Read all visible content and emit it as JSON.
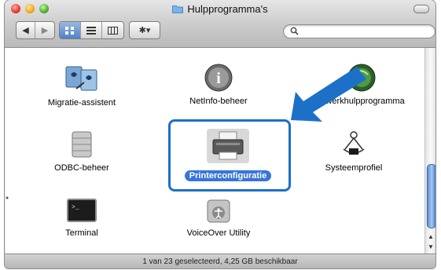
{
  "window": {
    "title": "Hulpprogramma's"
  },
  "toolbar": {
    "back_label": "◀",
    "forward_label": "▶",
    "action_label": "✱▾",
    "search_placeholder": ""
  },
  "items": [
    {
      "label": "Migratie-assistent"
    },
    {
      "label": "NetInfo-beheer"
    },
    {
      "label": "etwerkhulpprogramma"
    },
    {
      "label": "ODBC-beheer"
    },
    {
      "label": "Printerconfiguratie"
    },
    {
      "label": "Systeemprofiel"
    },
    {
      "label": "Terminal"
    },
    {
      "label": "VoiceOver Utility"
    }
  ],
  "status": {
    "text": "1 van 23 geselecteerd, 4,25 GB beschikbaar"
  },
  "colors": {
    "accent": "#1d70c8",
    "selection": "#3875d7"
  }
}
